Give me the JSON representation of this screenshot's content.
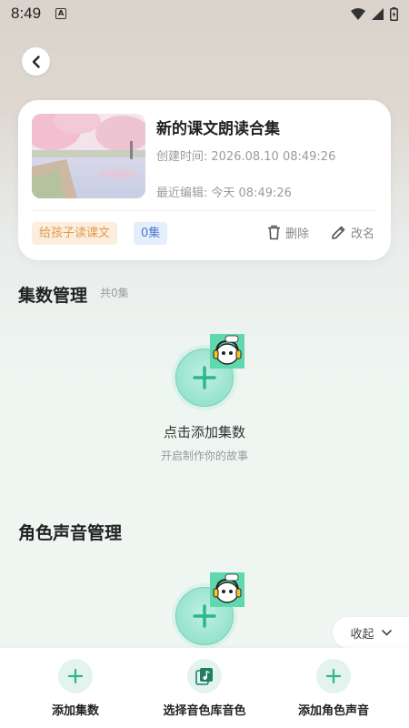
{
  "status_bar": {
    "time": "8:49",
    "notification_icon": "a-box-icon"
  },
  "collection": {
    "title": "新的课文朗读合集",
    "created_label": "创建时间:",
    "created_value": "2026.08.10 08:49:26",
    "edited_label": "最近编辑:",
    "edited_value": "今天 08:49:26",
    "tag": "给孩子读课文",
    "episode_count": "0集",
    "delete_label": "删除",
    "rename_label": "改名"
  },
  "episodes": {
    "title": "集数管理",
    "count": "共0集",
    "empty_title": "点击添加集数",
    "empty_subtitle": "开启制作你的故事"
  },
  "voices": {
    "title": "角色声音管理"
  },
  "collapse_label": "收起",
  "bottom_bar": {
    "items": [
      {
        "label": "添加集数",
        "icon": "plus-icon"
      },
      {
        "label": "选择音色库音色",
        "icon": "music-library-icon"
      },
      {
        "label": "添加角色声音",
        "icon": "plus-icon"
      }
    ]
  },
  "colors": {
    "accent": "#2fb58f",
    "tag_orange": "#e29a4c",
    "tag_blue": "#4f7ad0"
  }
}
